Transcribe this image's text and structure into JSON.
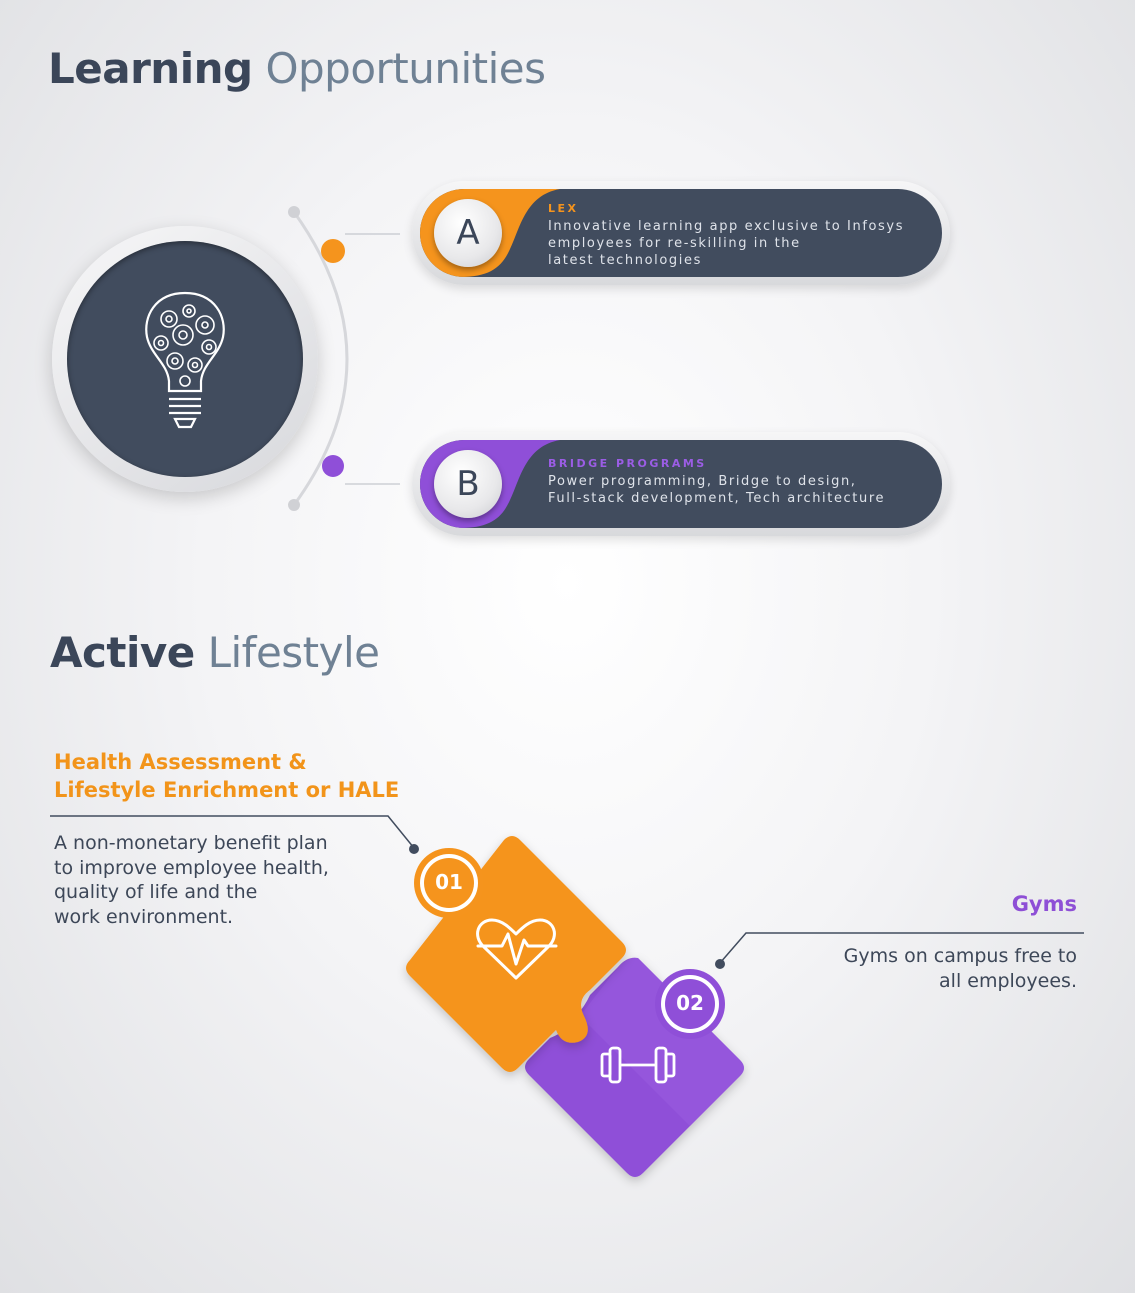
{
  "learning": {
    "title_bold": "Learning",
    "title_light": "Opportunities",
    "items": [
      {
        "badge": "A",
        "title": "LEX",
        "lines": [
          "Innovative learning app exclusive to Infosys",
          "employees for re-skilling in the",
          "latest technologies"
        ],
        "color": "#f5941d"
      },
      {
        "badge": "B",
        "title": "BRIDGE PROGRAMS",
        "lines": [
          "Power programming, Bridge to design,",
          "Full-stack development, Tech architecture"
        ],
        "color": "#8f4fd8"
      }
    ]
  },
  "active": {
    "title_bold": "Active",
    "title_light": "Lifestyle",
    "items": [
      {
        "number": "01",
        "title_lines": [
          "Health Assessment &",
          "Lifestyle Enrichment or HALE"
        ],
        "lines": [
          "A non-monetary benefit plan",
          "to improve employee health,",
          "quality of life and the",
          "work environment."
        ],
        "icon": "heartbeat-icon",
        "color": "#f5941d"
      },
      {
        "number": "02",
        "title_lines": [
          "Gyms"
        ],
        "lines": [
          "Gyms on campus free to",
          "all employees."
        ],
        "icon": "dumbbell-icon",
        "color": "#8f4fd8"
      }
    ]
  },
  "colors": {
    "dark": "#414c5e",
    "orange": "#f5941d",
    "purple": "#8f4fd8"
  },
  "icons": [
    "lightbulb-gears-icon",
    "heartbeat-icon",
    "dumbbell-icon"
  ]
}
